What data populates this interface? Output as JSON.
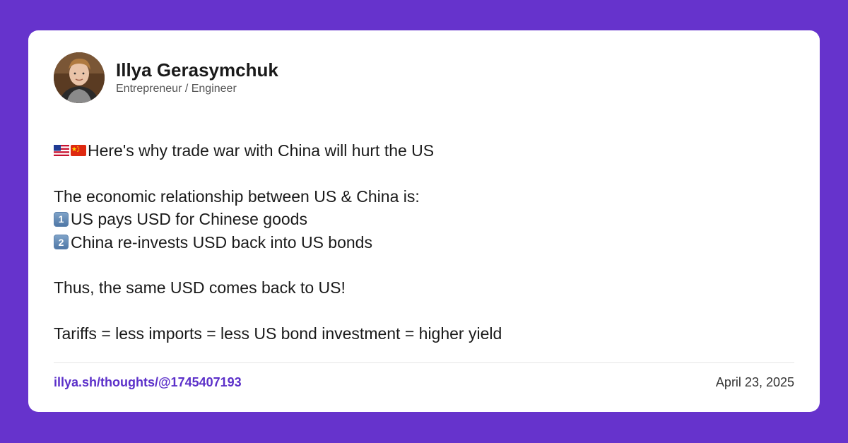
{
  "author": {
    "name": "Illya Gerasymchuk",
    "role": "Entrepreneur / Engineer"
  },
  "post": {
    "headline": "Here's why trade war with China will hurt the US",
    "intro": "The economic relationship between US & China is:",
    "point_1_num": "1",
    "point_1": "US pays USD for Chinese goods",
    "point_2_num": "2",
    "point_2": "China re-invests USD back into US bonds",
    "conclusion": "Thus, the same USD comes back to US!",
    "equation": "Tariffs = less imports = less US bond investment = higher yield"
  },
  "footer": {
    "link": "illya.sh/thoughts/@1745407193",
    "date": "April 23, 2025"
  },
  "colors": {
    "background": "#6633cc",
    "link": "#5b2fc9"
  },
  "icons": [
    "us-flag-icon",
    "china-flag-icon",
    "keycap-1-icon",
    "keycap-2-icon"
  ]
}
